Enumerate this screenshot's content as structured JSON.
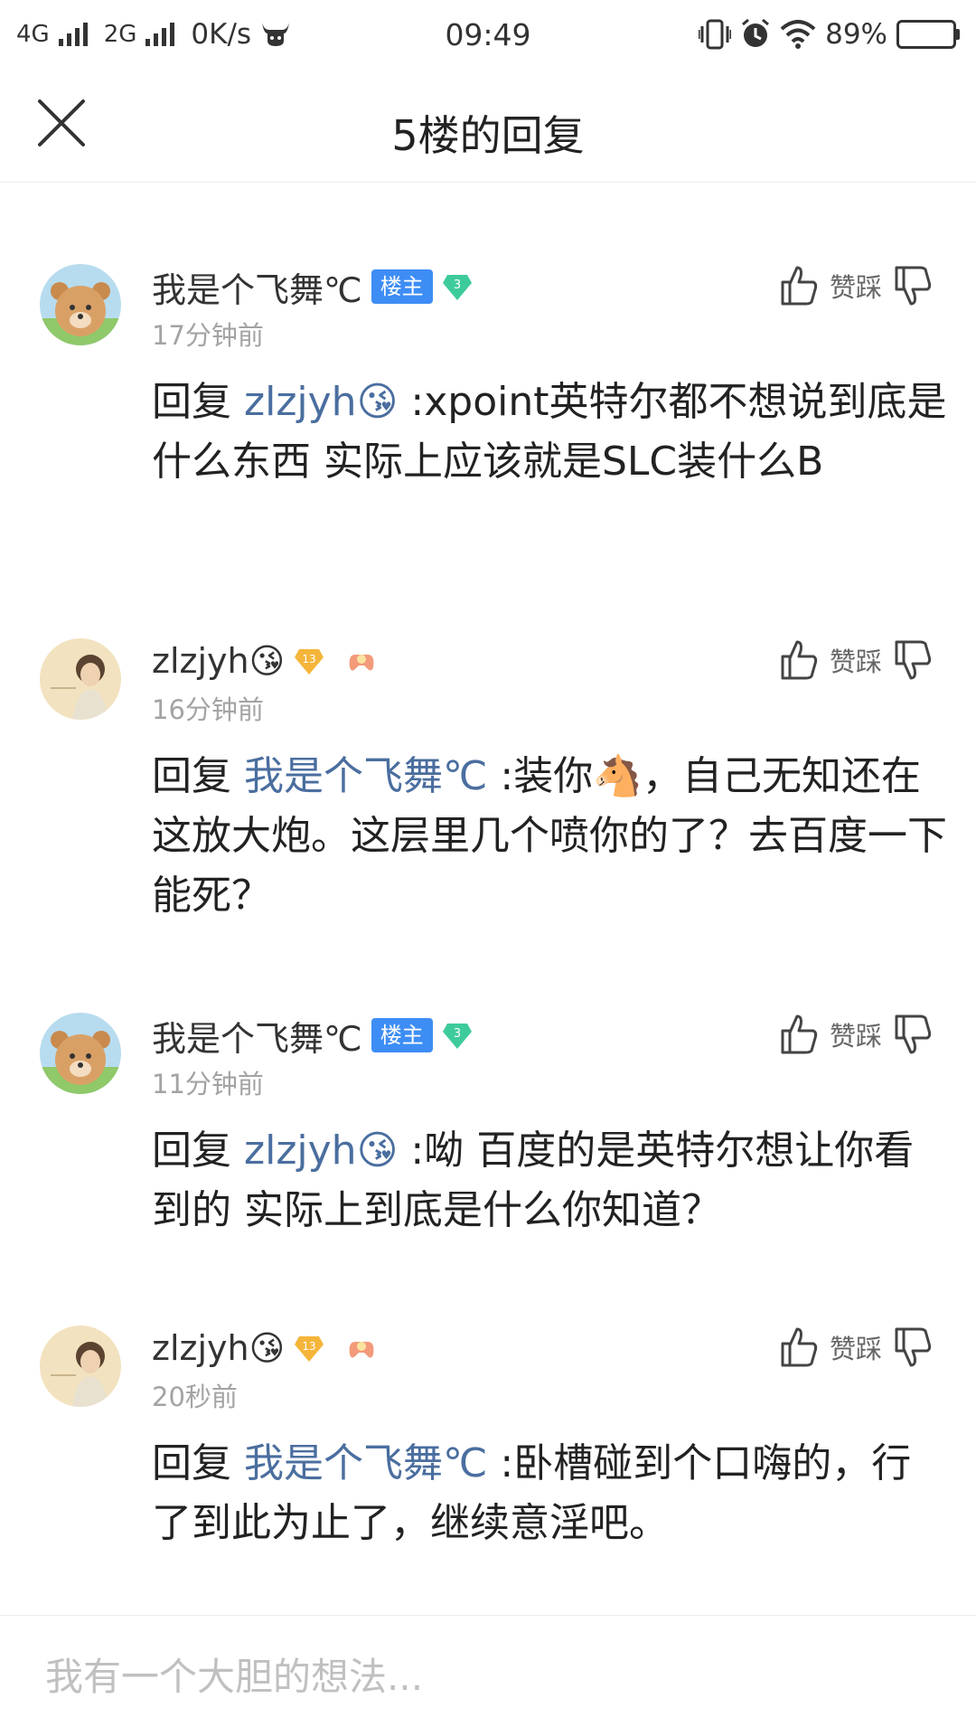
{
  "status_bar": {
    "network1": "4G",
    "network2": "2G",
    "speed": "0K/s",
    "time": "09:49",
    "battery": "89%",
    "battery_level": 0.89
  },
  "header": {
    "title": "5楼的回复"
  },
  "actions": {
    "like_dislike_label": "赞踩"
  },
  "replies": [
    {
      "username": "我是个飞舞℃",
      "badge": "楼主",
      "level": "3",
      "time": "17分钟前",
      "prefix": "回复 ",
      "mention": "zlzjyh😘",
      "text": " :xpoint英特尔都不想说到底是什么东西 实际上应该就是SLC装什么B"
    },
    {
      "username": "zlzjyh😘",
      "level": "13",
      "time": "16分钟前",
      "prefix": "回复 ",
      "mention": "我是个飞舞℃",
      "text": " :装你🐴，自己无知还在这放大炮。这层里几个喷你的了？去百度一下能死？"
    },
    {
      "username": "我是个飞舞℃",
      "badge": "楼主",
      "level": "3",
      "time": "11分钟前",
      "prefix": "回复 ",
      "mention": "zlzjyh😘",
      "text": " :呦 百度的是英特尔想让你看到的 实际上到底是什么你知道？"
    },
    {
      "username": "zlzjyh😘",
      "level": "13",
      "time": "20秒前",
      "prefix": "回复 ",
      "mention": "我是个飞舞℃",
      "text": " :卧槽碰到个口嗨的，行了到此为止了，继续意淫吧。"
    }
  ],
  "input": {
    "placeholder": "我有一个大胆的想法..."
  },
  "colors": {
    "owner_badge": "#3d8df5",
    "mention": "#4a6e9f",
    "level_green": "#3ecb9b",
    "level_gold": "#f5b53a",
    "muted": "#a3a3a3"
  }
}
